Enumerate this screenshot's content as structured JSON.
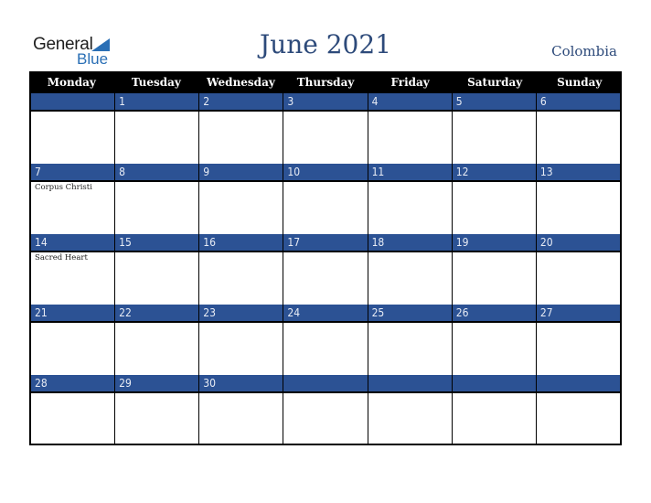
{
  "logo": {
    "line1": "General",
    "line2": "Blue",
    "icon": "triangle-flag-icon"
  },
  "header": {
    "title": "June 2021",
    "country": "Colombia"
  },
  "colors": {
    "accent": "#2c5294",
    "title": "#2d4a7a",
    "header_bg": "#000000"
  },
  "weekdays": [
    "Monday",
    "Tuesday",
    "Wednesday",
    "Thursday",
    "Friday",
    "Saturday",
    "Sunday"
  ],
  "weeks": [
    {
      "days": [
        {
          "date": "",
          "holiday": ""
        },
        {
          "date": "1",
          "holiday": ""
        },
        {
          "date": "2",
          "holiday": ""
        },
        {
          "date": "3",
          "holiday": ""
        },
        {
          "date": "4",
          "holiday": ""
        },
        {
          "date": "5",
          "holiday": ""
        },
        {
          "date": "6",
          "holiday": ""
        }
      ]
    },
    {
      "days": [
        {
          "date": "7",
          "holiday": "Corpus Christi"
        },
        {
          "date": "8",
          "holiday": ""
        },
        {
          "date": "9",
          "holiday": ""
        },
        {
          "date": "10",
          "holiday": ""
        },
        {
          "date": "11",
          "holiday": ""
        },
        {
          "date": "12",
          "holiday": ""
        },
        {
          "date": "13",
          "holiday": ""
        }
      ]
    },
    {
      "days": [
        {
          "date": "14",
          "holiday": "Sacred Heart"
        },
        {
          "date": "15",
          "holiday": ""
        },
        {
          "date": "16",
          "holiday": ""
        },
        {
          "date": "17",
          "holiday": ""
        },
        {
          "date": "18",
          "holiday": ""
        },
        {
          "date": "19",
          "holiday": ""
        },
        {
          "date": "20",
          "holiday": ""
        }
      ]
    },
    {
      "days": [
        {
          "date": "21",
          "holiday": ""
        },
        {
          "date": "22",
          "holiday": ""
        },
        {
          "date": "23",
          "holiday": ""
        },
        {
          "date": "24",
          "holiday": ""
        },
        {
          "date": "25",
          "holiday": ""
        },
        {
          "date": "26",
          "holiday": ""
        },
        {
          "date": "27",
          "holiday": ""
        }
      ]
    },
    {
      "days": [
        {
          "date": "28",
          "holiday": ""
        },
        {
          "date": "29",
          "holiday": ""
        },
        {
          "date": "30",
          "holiday": ""
        },
        {
          "date": "",
          "holiday": ""
        },
        {
          "date": "",
          "holiday": ""
        },
        {
          "date": "",
          "holiday": ""
        },
        {
          "date": "",
          "holiday": ""
        }
      ]
    }
  ]
}
